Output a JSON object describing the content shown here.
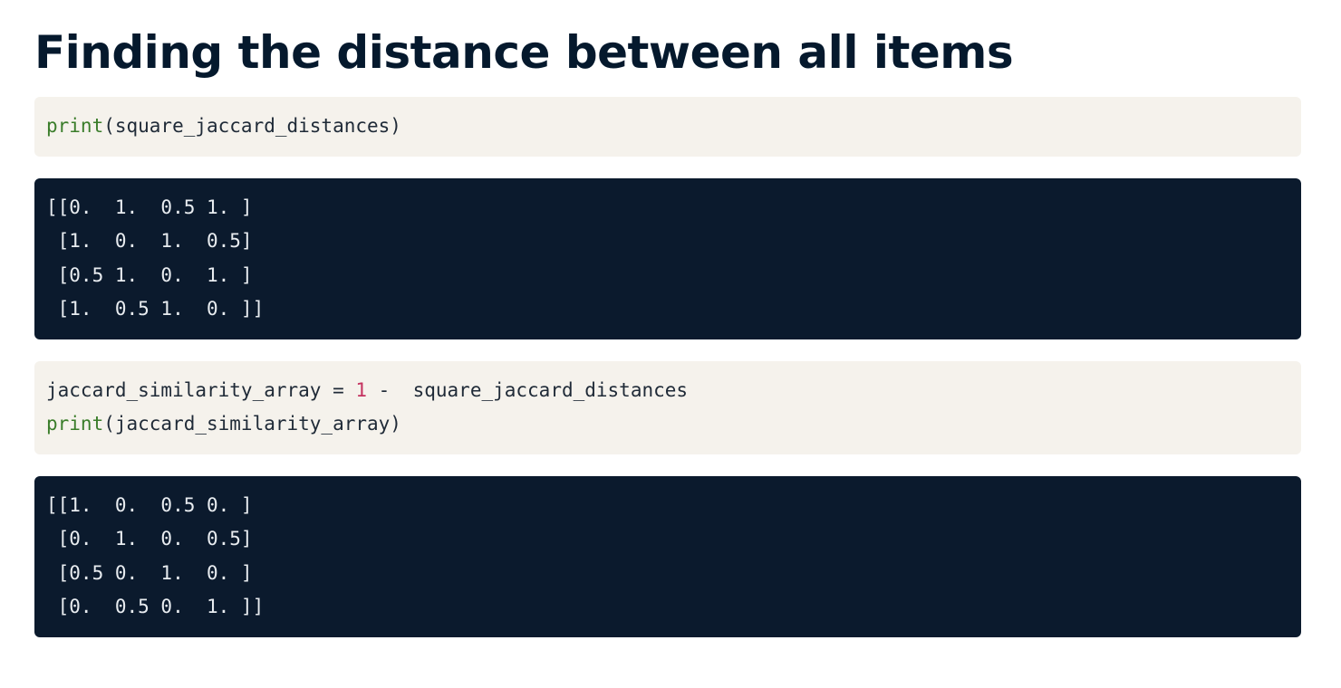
{
  "title": "Finding the distance between all items",
  "code_input_1": {
    "func": "print",
    "rest": "(square_jaccard_distances)"
  },
  "output_1": {
    "lines": [
      "[[0.  1.  0.5 1. ]",
      " [1.  0.  1.  0.5]",
      " [0.5 1.  0.  1. ]",
      " [1.  0.5 1.  0. ]]"
    ]
  },
  "code_input_2": {
    "line1_pre": "jaccard_similarity_array = ",
    "line1_num": "1",
    "line1_post": " -  square_jaccard_distances",
    "line2_func": "print",
    "line2_rest": "(jaccard_similarity_array)"
  },
  "output_2": {
    "lines": [
      "[[1.  0.  0.5 0. ]",
      " [0.  1.  0.  0.5]",
      " [0.5 0.  1.  0. ]",
      " [0.  0.5 0.  1. ]]"
    ]
  },
  "colors": {
    "title": "#05192d",
    "input_background": "#f5f2ec",
    "output_background": "#0b1a2d",
    "function_keyword": "#3a7d2a",
    "number_literal": "#c4325f"
  }
}
